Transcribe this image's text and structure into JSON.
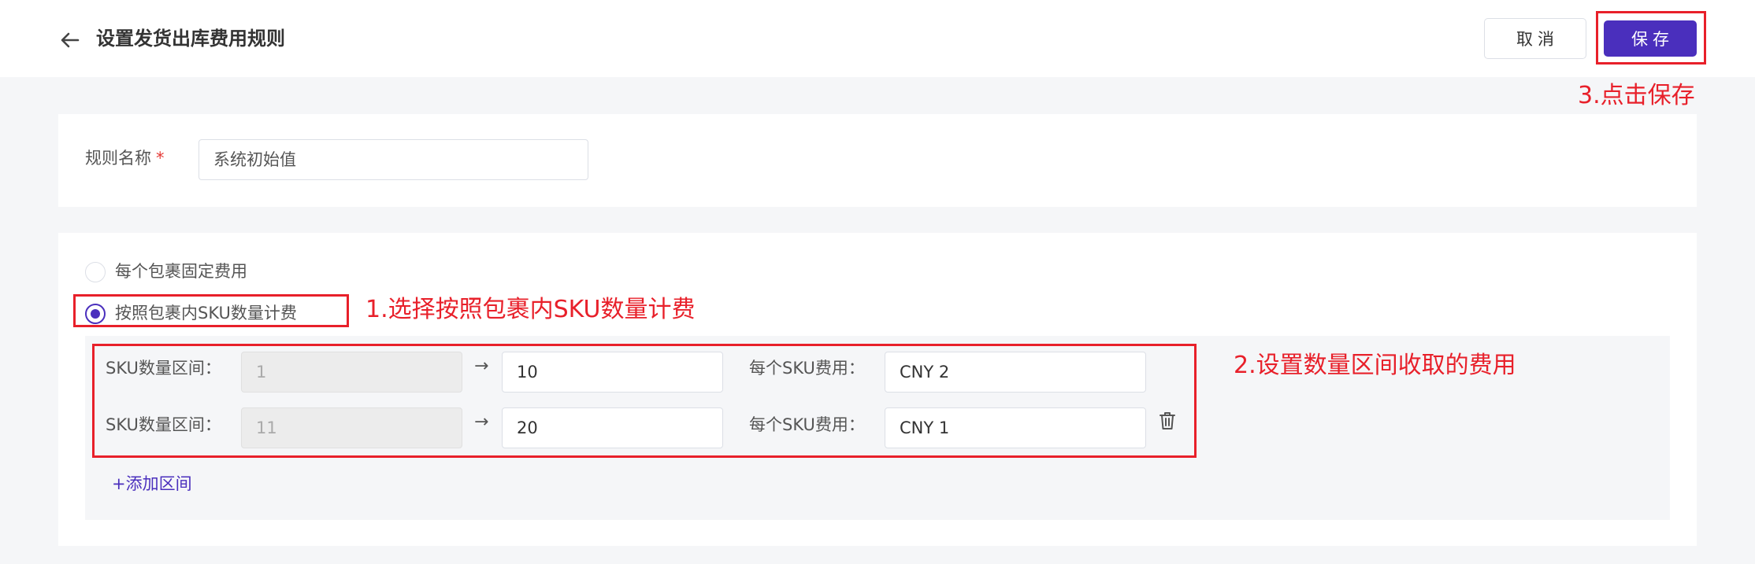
{
  "header": {
    "title": "设置发货出库费用规则",
    "cancel_label": "取消",
    "save_label": "保存"
  },
  "rule": {
    "name_label": "规则名称",
    "required_mark": "*",
    "name_value": "系统初始值"
  },
  "pricing": {
    "options": [
      {
        "label": "每个包裹固定费用",
        "selected": false
      },
      {
        "label": "按照包裹内SKU数量计费",
        "selected": true
      }
    ],
    "ranges": [
      {
        "range_label": "SKU数量区间：",
        "from": "1",
        "arrow": "→",
        "to": "10",
        "fee_label": "每个SKU费用：",
        "fee": "CNY 2"
      },
      {
        "range_label": "SKU数量区间：",
        "from": "11",
        "arrow": "→",
        "to": "20",
        "fee_label": "每个SKU费用：",
        "fee": "CNY 1"
      }
    ],
    "add_range_label": "+添加区间"
  },
  "annotations": {
    "step1": "1.选择按照包裹内SKU数量计费",
    "step2": "2.设置数量区间收取的费用",
    "step3": "3.点击保存"
  },
  "colors": {
    "accent": "#4a2fbd",
    "annotation": "#e8202a"
  },
  "icons": {
    "back": "arrow-left-icon",
    "delete": "trash-icon"
  }
}
